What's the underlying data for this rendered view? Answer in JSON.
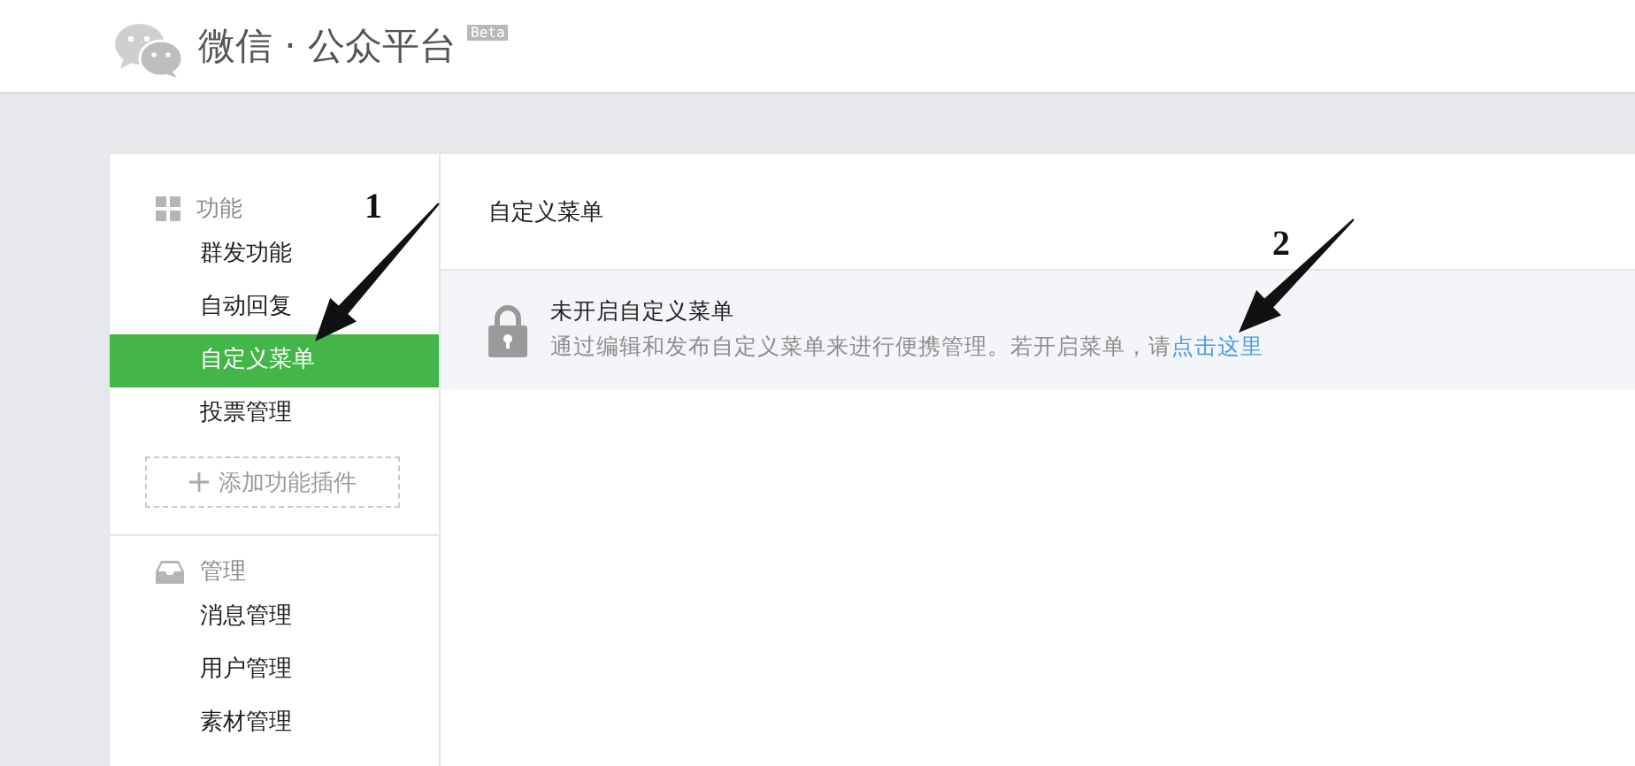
{
  "header": {
    "title": "微信 · 公众平台",
    "badge": "Beta"
  },
  "sidebar": {
    "sections": [
      {
        "title": "功能",
        "kind": "grid",
        "items": [
          {
            "label": "群发功能",
            "selected": false
          },
          {
            "label": "自动回复",
            "selected": false
          },
          {
            "label": "自定义菜单",
            "selected": true
          },
          {
            "label": "投票管理",
            "selected": false
          }
        ],
        "add_button": "添加功能插件"
      },
      {
        "title": "管理",
        "kind": "tray",
        "items": [
          {
            "label": "消息管理",
            "selected": false
          },
          {
            "label": "用户管理",
            "selected": false
          },
          {
            "label": "素材管理",
            "selected": false
          }
        ]
      }
    ]
  },
  "content": {
    "title": "自定义菜单",
    "notice": {
      "title": "未开启自定义菜单",
      "text": "通过编辑和发布自定义菜单来进行便携管理。若开启菜单，请",
      "link": "点击这里"
    }
  },
  "annotations": [
    {
      "label": "1"
    },
    {
      "label": "2"
    }
  ]
}
